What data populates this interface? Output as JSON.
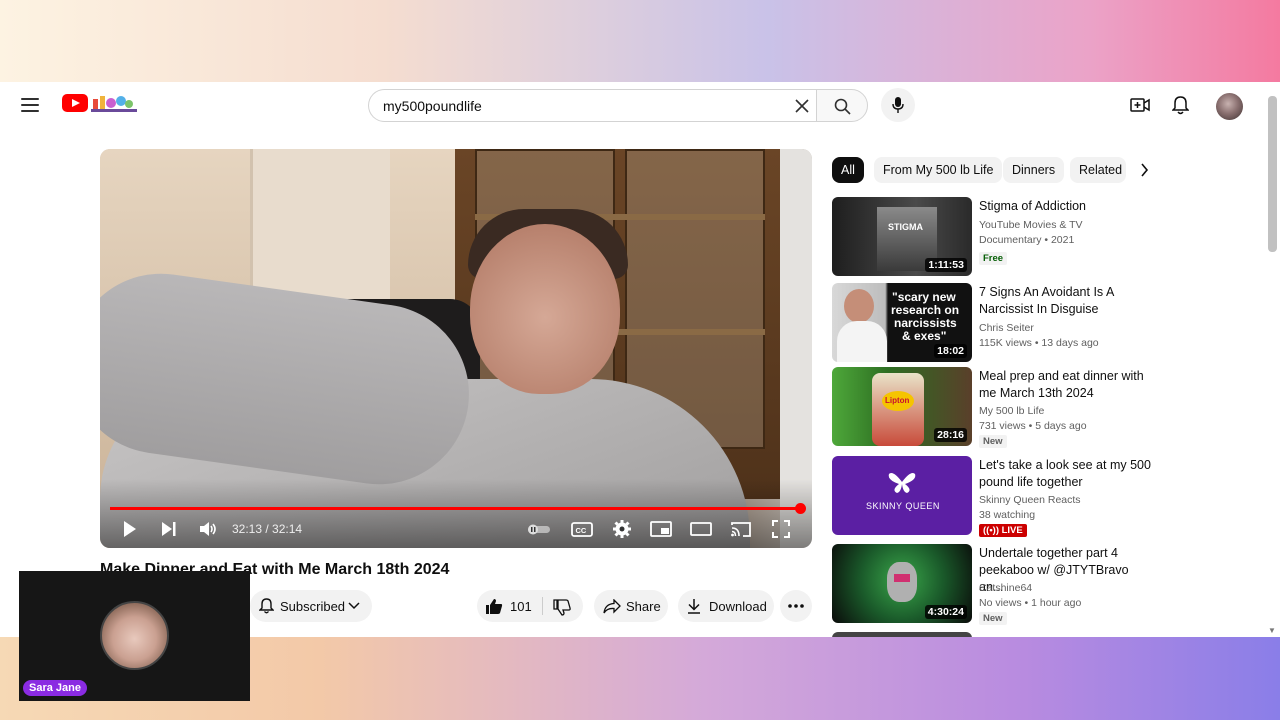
{
  "search": {
    "query": "my500poundlife"
  },
  "player": {
    "time": "32:13 / 32:14",
    "progress": 0.999
  },
  "video": {
    "title": "Make Dinner and Eat with Me March 18th 2024",
    "subscribe_label": "Subscribed",
    "likes": "101",
    "share_label": "Share",
    "download_label": "Download"
  },
  "chips": [
    "All",
    "From My 500 lb Life",
    "Dinners",
    "Related"
  ],
  "recommendations": [
    {
      "title": "Stigma of Addiction",
      "channel": "YouTube Movies & TV",
      "meta": "Documentary • 2021",
      "badge": "Free",
      "duration": "1:11:53"
    },
    {
      "title": "7 Signs An Avoidant Is A Narcissist In Disguise",
      "channel": "Chris Seiter",
      "meta": "115K views • 13 days ago",
      "badge": "",
      "duration": "18:02"
    },
    {
      "title": "Meal prep and eat dinner with me March 13th 2024",
      "channel": "My 500 lb Life",
      "meta": "731 views • 5 days ago",
      "badge": "New",
      "duration": "28:16"
    },
    {
      "title": "Let's take a look see at my 500 pound life together",
      "channel": "Skinny Queen Reacts",
      "meta": "38 watching",
      "badge": "LIVE",
      "duration": ""
    },
    {
      "title": "Undertale together part 4 peekaboo w/ @JTYTBravo an...",
      "channel": "Catshine64",
      "meta": "No views • 1 hour ago",
      "badge": "New",
      "duration": "4:30:24"
    }
  ],
  "thumb_text": {
    "stigma": "STIGMA",
    "scary_1": "\"scary new",
    "scary_2": "research on",
    "scary_3": "narcissists",
    "scary_4": "& exes\"",
    "lipton": "Lipton",
    "skinny_queen": "SKINNY QUEEN"
  },
  "webcam": {
    "name": "Sara Jane"
  }
}
